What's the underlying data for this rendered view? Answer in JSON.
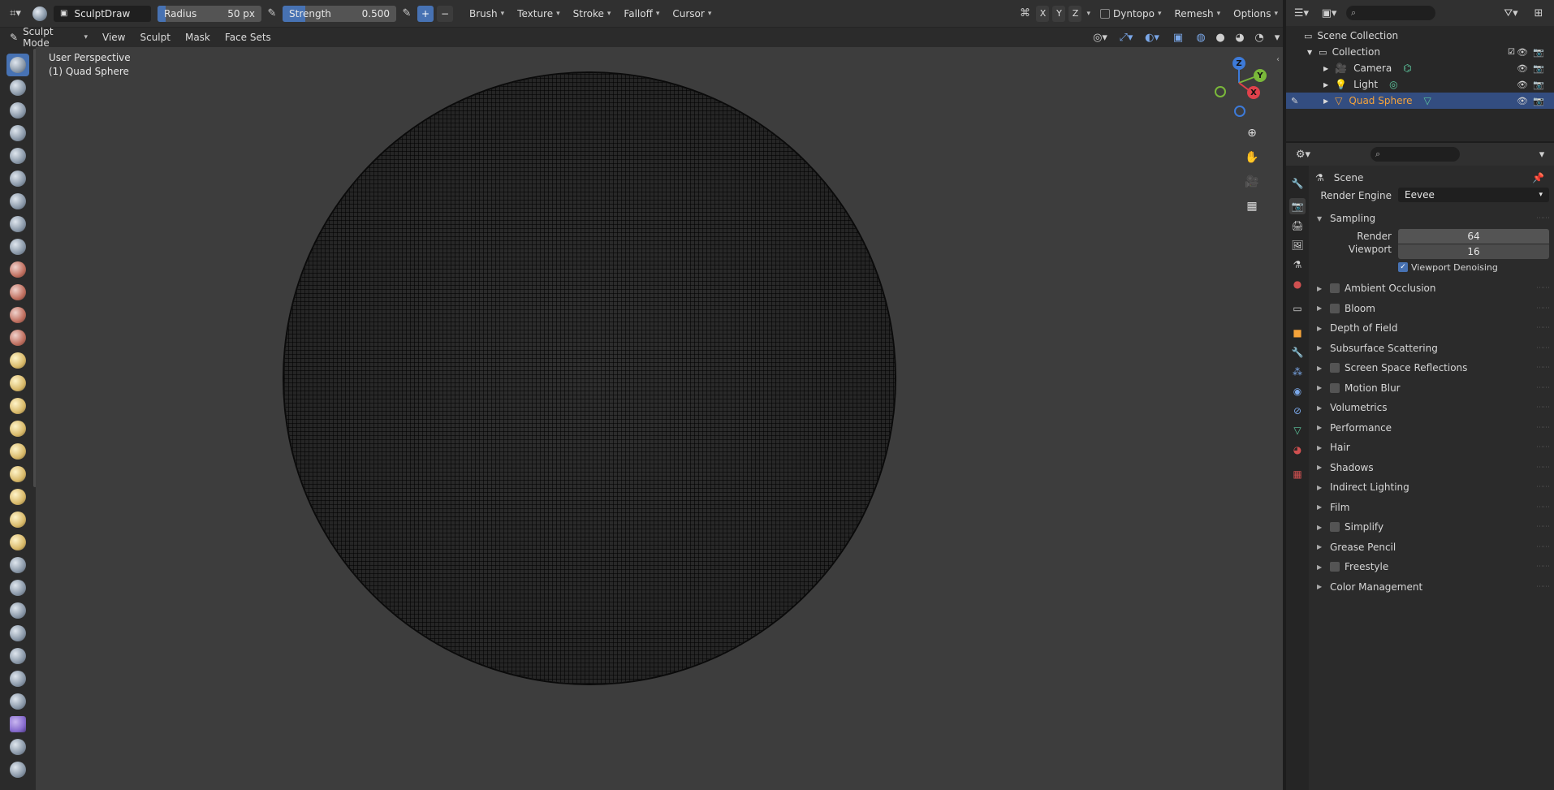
{
  "topbar": {
    "brush_name": "SculptDraw",
    "radius_label": "Radius",
    "radius_value": "50 px",
    "strength_label": "Strength",
    "strength_value": "0.500",
    "strength_fraction": 0.5,
    "menus": [
      "Brush",
      "Texture",
      "Stroke",
      "Falloff",
      "Cursor"
    ],
    "axes": [
      "X",
      "Y",
      "Z"
    ],
    "dyntopo": "Dyntopo",
    "remesh": "Remesh",
    "options": "Options"
  },
  "header": {
    "mode": "Sculpt Mode",
    "menus": [
      "View",
      "Sculpt",
      "Mask",
      "Face Sets"
    ]
  },
  "viewport": {
    "perspective": "User Perspective",
    "object": "(1) Quad Sphere",
    "gizmo": {
      "z": "Z",
      "y": "Y",
      "x": "X"
    }
  },
  "outliner": {
    "scene_collection": "Scene Collection",
    "collection": "Collection",
    "items": [
      {
        "label": "Camera",
        "selected": false
      },
      {
        "label": "Light",
        "selected": false
      },
      {
        "label": "Quad Sphere",
        "selected": true
      }
    ]
  },
  "properties": {
    "context": "Scene",
    "render_engine_label": "Render Engine",
    "render_engine_value": "Eevee",
    "sampling": "Sampling",
    "render_label": "Render",
    "render_value": "64",
    "viewport_label": "Viewport",
    "viewport_value": "16",
    "denoise_label": "Viewport Denoising",
    "sections": [
      {
        "label": "Ambient Occlusion",
        "checkbox": true
      },
      {
        "label": "Bloom",
        "checkbox": true
      },
      {
        "label": "Depth of Field",
        "checkbox": false
      },
      {
        "label": "Subsurface Scattering",
        "checkbox": false
      },
      {
        "label": "Screen Space Reflections",
        "checkbox": true
      },
      {
        "label": "Motion Blur",
        "checkbox": true
      },
      {
        "label": "Volumetrics",
        "checkbox": false
      },
      {
        "label": "Performance",
        "checkbox": false
      },
      {
        "label": "Hair",
        "checkbox": false
      },
      {
        "label": "Shadows",
        "checkbox": false
      },
      {
        "label": "Indirect Lighting",
        "checkbox": false
      },
      {
        "label": "Film",
        "checkbox": false
      },
      {
        "label": "Simplify",
        "checkbox": true
      },
      {
        "label": "Grease Pencil",
        "checkbox": false
      },
      {
        "label": "Freestyle",
        "checkbox": true
      },
      {
        "label": "Color Management",
        "checkbox": false
      }
    ]
  },
  "colors": {
    "accent": "#4772b3",
    "selected_row": "#334d80",
    "active_text": "#f5a33a"
  }
}
